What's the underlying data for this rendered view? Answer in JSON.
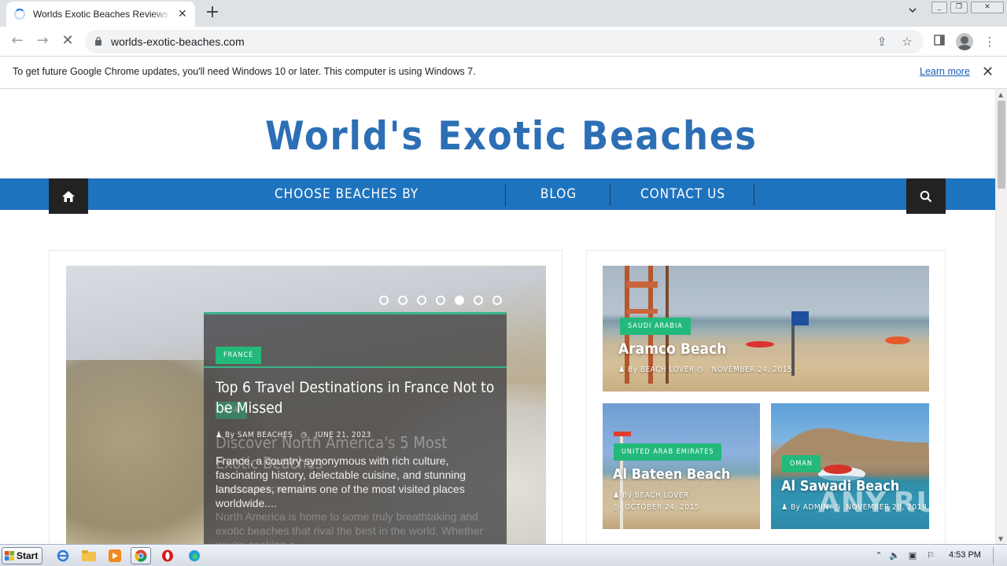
{
  "browser": {
    "tab_title": "Worlds Exotic Beaches Reviews, Travel",
    "url": "worlds-exotic-beaches.com",
    "infobar_text": "To get future Google Chrome updates, you'll need Windows 10 or later. This computer is using Windows 7.",
    "learn_more": "Learn more"
  },
  "site": {
    "logo": "World's Exotic Beaches",
    "menu": {
      "continents": "CHOOSE BEACHES BY CONTINENTS",
      "blog": "BLOG",
      "contact": "CONTACT US"
    }
  },
  "slider": {
    "dots_total": 7,
    "active_dot": 5,
    "current": {
      "category": "FRANCE",
      "title": "Top 6 Travel Destinations in France Not to be Missed",
      "author": "By SAM BEACHES",
      "date": "JUNE 21, 2023",
      "excerpt": "France, a country synonymous with rich culture, fascinating history, delectable cuisine, and stunning landscapes, remains one of the most visited places worldwide...."
    },
    "ghost": {
      "category": "USA",
      "title": "Discover North America's 5 Most Exotic Beaches",
      "meta": "& By SAM BEACHES JUNE",
      "excerpt": "North America is home to some truly breathtaking and exotic beaches that rival the best in the world. Whether you're seeking a"
    }
  },
  "featured": [
    {
      "category": "SAUDI ARABIA",
      "title": "Aramco Beach",
      "author": "By BEACH LOVER",
      "date": "NOVEMBER 24, 2015"
    },
    {
      "category": "UNITED ARAB EMIRATES",
      "title": "Al Bateen Beach",
      "author": "By BEACH LOVER",
      "date": "OCTOBER 24, 2015"
    },
    {
      "category": "OMAN",
      "title": "Al Sawadi Beach",
      "author": "By ADMIN",
      "date": "NOVEMBER 20, 2019"
    }
  ],
  "watermark": "ANY.RUN",
  "taskbar": {
    "start": "Start",
    "clock": "4:53 PM"
  },
  "colors": {
    "brand_blue": "#1e73be",
    "badge_green": "#23b97a",
    "dark": "#222222"
  }
}
